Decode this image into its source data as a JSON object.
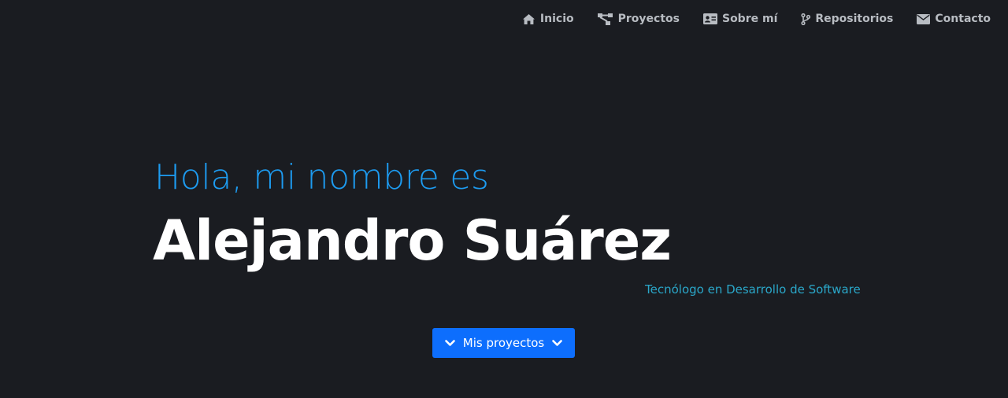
{
  "nav": {
    "items": [
      {
        "label": "Inicio",
        "icon": "home-icon"
      },
      {
        "label": "Proyectos",
        "icon": "sitemap-icon"
      },
      {
        "label": "Sobre mí",
        "icon": "id-card-icon"
      },
      {
        "label": "Repositorios",
        "icon": "code-branch-icon"
      },
      {
        "label": "Contacto",
        "icon": "envelope-icon"
      }
    ]
  },
  "hero": {
    "greeting": "Hola, mi nombre es",
    "name": "Alejandro Suárez",
    "subtitle": "Tecnólogo en Desarrollo de Software",
    "cta_label": "Mis proyectos"
  },
  "colors": {
    "background": "#1a1c21",
    "accent": "#1d9bf0",
    "subtitle": "#2aa7c9",
    "button": "#0d6efd",
    "nav_text": "#b8bcc2"
  }
}
